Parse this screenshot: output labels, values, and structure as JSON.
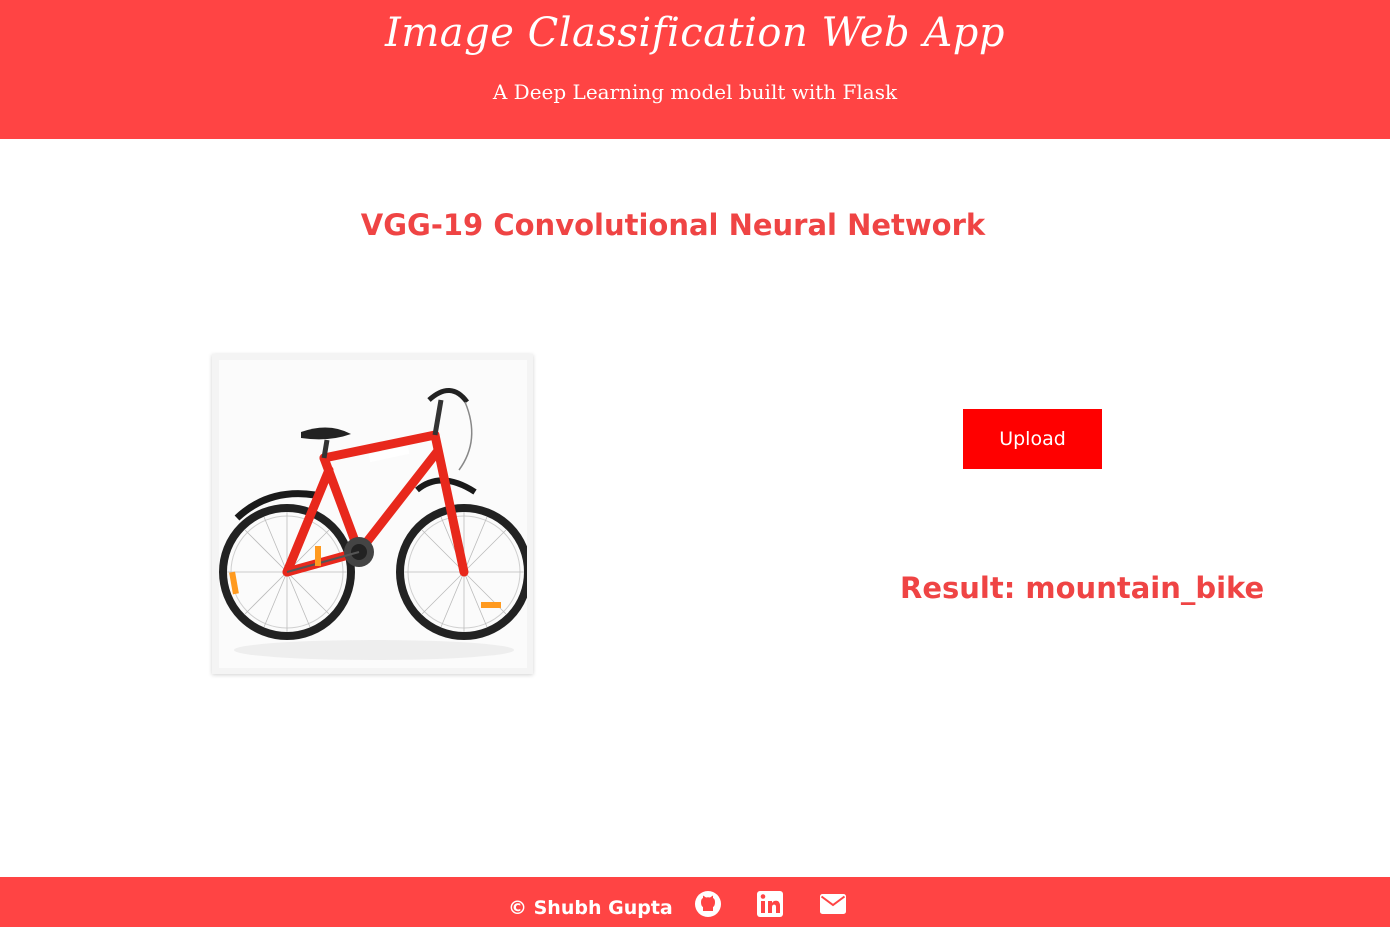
{
  "header": {
    "title": "Image Classification Web App",
    "subtitle": "A Deep Learning model built with Flask"
  },
  "main": {
    "model_title": "VGG-19 Convolutional Neural Network",
    "upload_label": "Upload",
    "result_text": "Result: mountain_bike",
    "preview_icon": "bicycle-image"
  },
  "footer": {
    "copyright": "© Shubh Gupta",
    "icons": [
      "github-icon",
      "linkedin-icon",
      "email-icon"
    ]
  },
  "colors": {
    "brand": "#ff4444",
    "accent_text": "#ef4444",
    "button": "#ff0000"
  }
}
